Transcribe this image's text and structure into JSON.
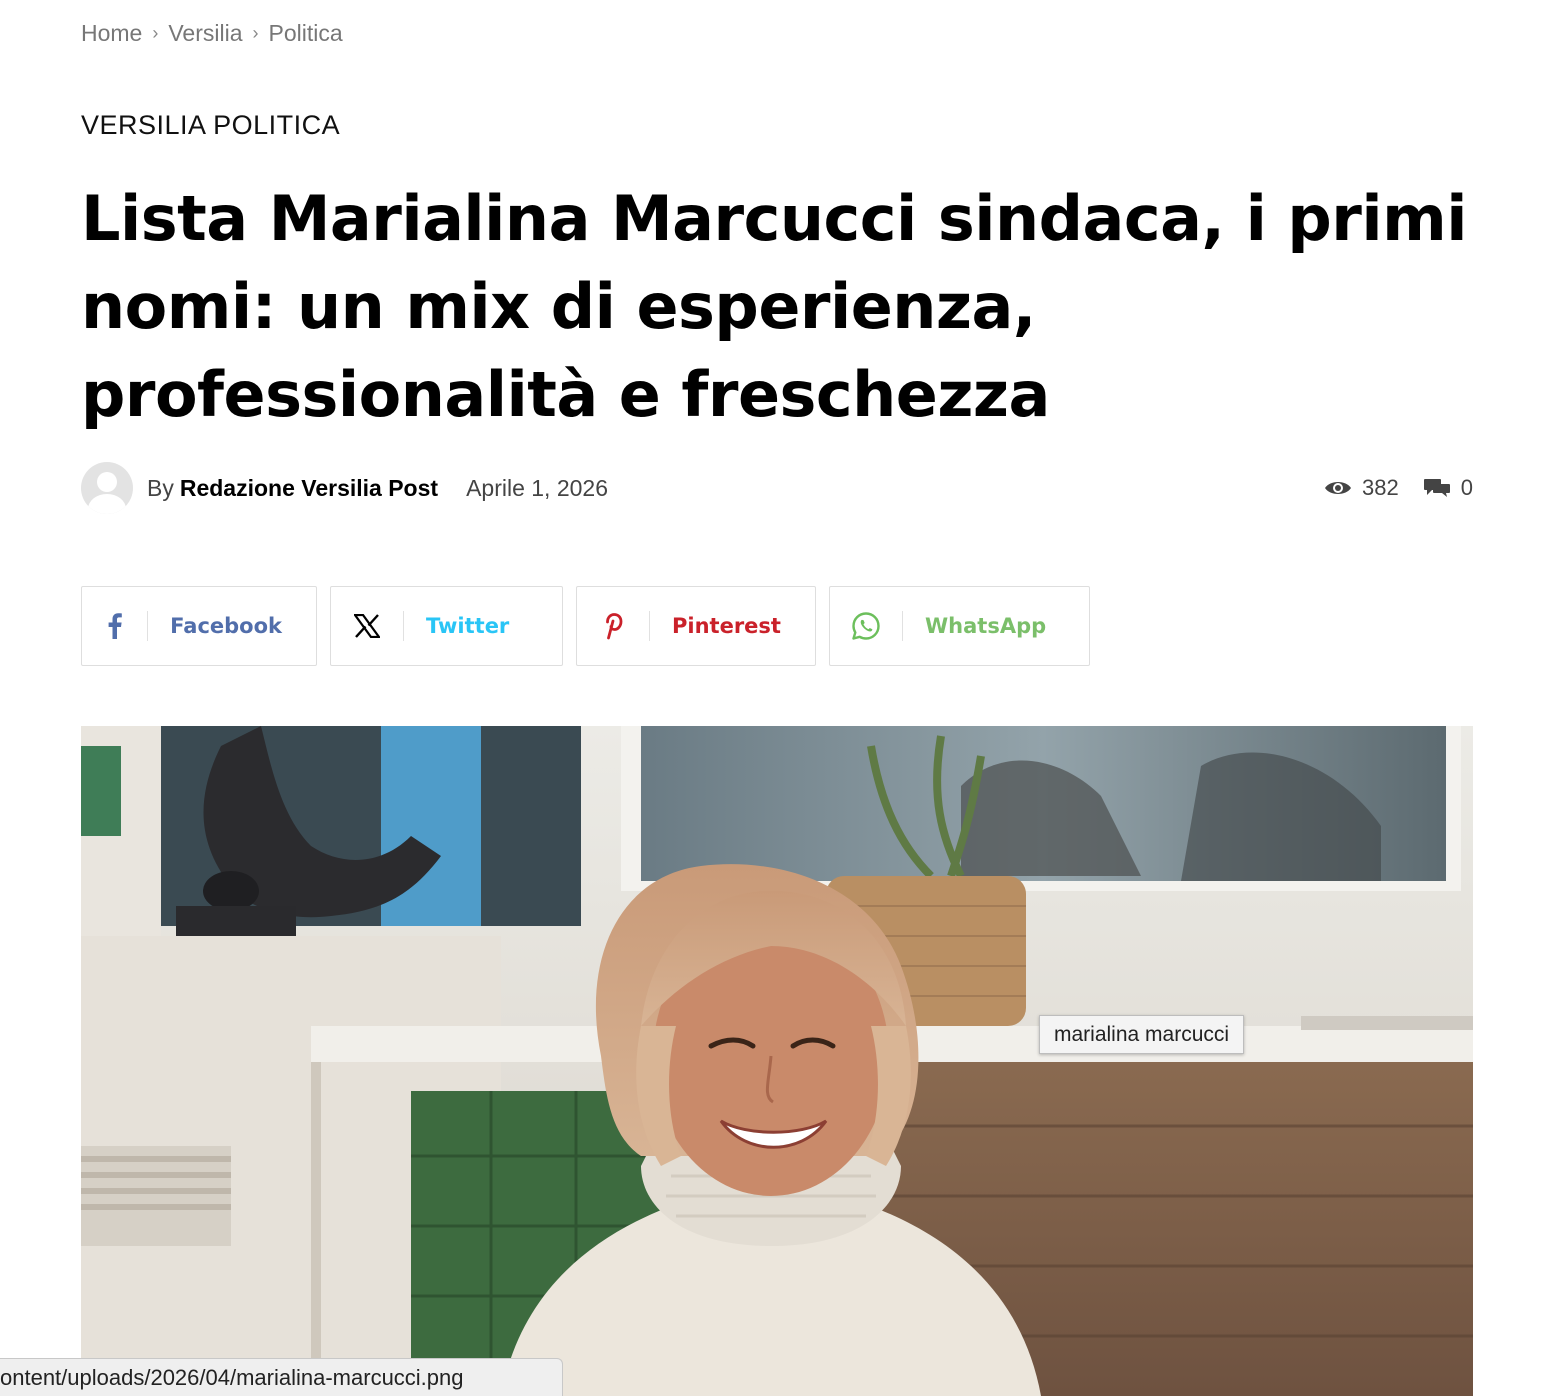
{
  "breadcrumb": {
    "home": "Home",
    "sep": "›",
    "section": "Versilia",
    "page": "Politica"
  },
  "category": "VERSILIA POLITICA",
  "title": "Lista Marialina Marcucci sindaca, i primi nomi: un mix di esperienza, professionalità e freschezza",
  "meta": {
    "by": "By",
    "author": "Redazione Versilia Post",
    "date": "Aprile 1, 2026",
    "views": "382",
    "comments": "0",
    "views_icon": "eye-icon",
    "comments_icon": "comments-icon"
  },
  "share": {
    "facebook": {
      "label": "Facebook",
      "icon": "facebook-icon",
      "color": "#516eab"
    },
    "twitter": {
      "label": "Twitter",
      "icon": "x-icon",
      "color": "#29c5f6"
    },
    "pinterest": {
      "label": "Pinterest",
      "icon": "pinterest-icon",
      "color": "#ca212a"
    },
    "whatsapp": {
      "label": "WhatsApp",
      "icon": "whatsapp-icon",
      "color": "#7bbf6a"
    }
  },
  "image": {
    "tooltip": "marialina marcucci"
  },
  "status_url": "ontent/uploads/2026/04/marialina-marcucci.png"
}
